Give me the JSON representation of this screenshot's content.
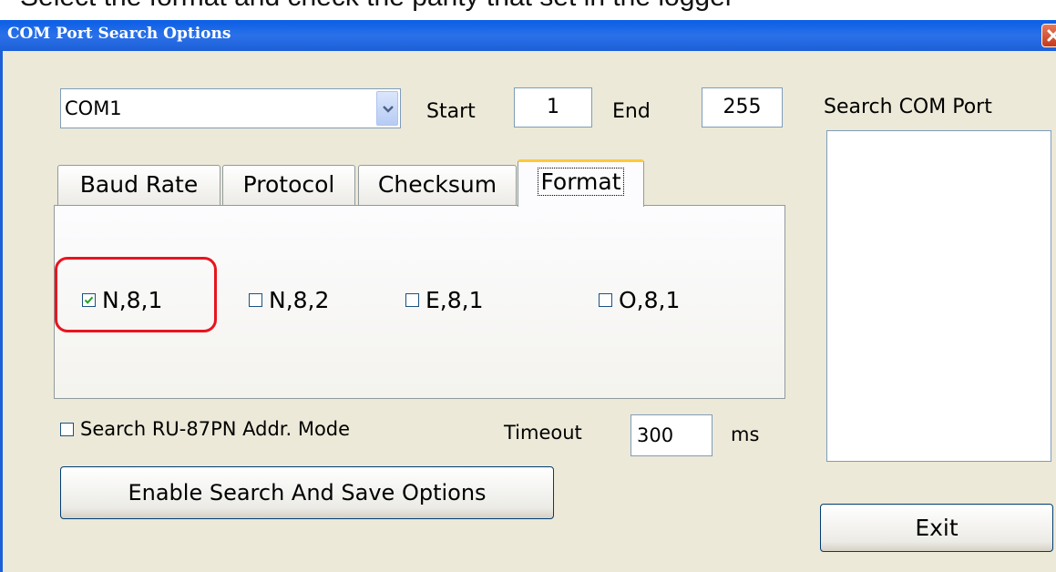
{
  "top_caption": "Select the format and check the parity that set in the logger",
  "window": {
    "title": "COM Port Search Options"
  },
  "com_select": {
    "value": "COM1"
  },
  "range": {
    "start_label": "Start",
    "start_value": "1",
    "end_label": "End",
    "end_value": "255"
  },
  "tabs": [
    {
      "label": "Baud Rate"
    },
    {
      "label": "Protocol"
    },
    {
      "label": "Checksum"
    },
    {
      "label": "Format",
      "active": true
    }
  ],
  "formats": [
    {
      "label": "N,8,1",
      "checked": true
    },
    {
      "label": "N,8,2",
      "checked": false
    },
    {
      "label": "E,8,1",
      "checked": false
    },
    {
      "label": "O,8,1",
      "checked": false
    }
  ],
  "addr_mode": {
    "label": "Search RU-87PN Addr. Mode",
    "checked": false
  },
  "timeout": {
    "label": "Timeout",
    "value": "300",
    "unit": "ms"
  },
  "enable_button": {
    "label": "Enable Search And Save  Options"
  },
  "search_panel": {
    "label": "Search COM Port"
  },
  "exit_button": {
    "label": "Exit"
  },
  "colors": {
    "titlebar": "#1c5fd8",
    "window_bg": "#ece9d8",
    "active_tab_accent": "#ffc83c",
    "highlight": "#e8141e",
    "check": "#21a121"
  },
  "icons": [
    "chevron-down-icon",
    "close-icon",
    "check-icon"
  ]
}
